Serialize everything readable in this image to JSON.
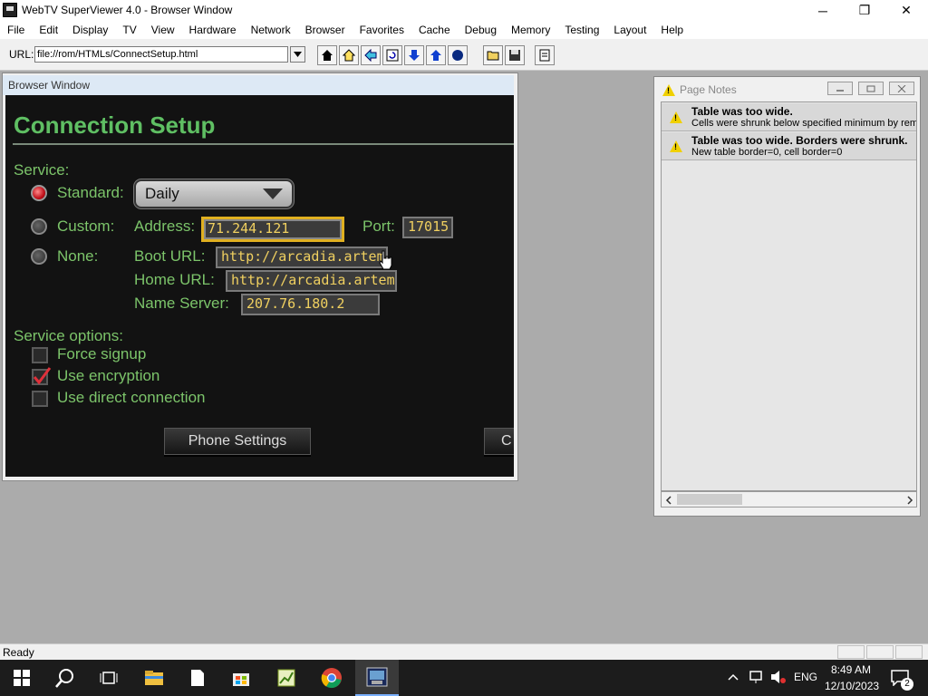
{
  "window": {
    "title": "WebTV SuperViewer 4.0 - Browser Window",
    "minimize_glyph": "─",
    "maximize_glyph": "❐",
    "close_glyph": "✕"
  },
  "menu": [
    "File",
    "Edit",
    "Display",
    "TV",
    "View",
    "Hardware",
    "Network",
    "Browser",
    "Favorites",
    "Cache",
    "Debug",
    "Memory",
    "Testing",
    "Layout",
    "Help"
  ],
  "toolbar": {
    "url_label": "URL:",
    "url_value": "file://rom/HTMLs/ConnectSetup.html",
    "buttons": [
      "home-dark-icon",
      "home-icon",
      "back-arrow-icon",
      "reload-icon",
      "down-arrow-icon",
      "up-arrow-icon",
      "stop-icon",
      "open-folder-icon",
      "save-disk-icon",
      "page-icon"
    ]
  },
  "browser_window": {
    "title": "Browser Window",
    "heading": "Connection Setup",
    "service_label": "Service:",
    "standard_label": "Standard:",
    "standard_value": "Daily",
    "custom_label": "Custom:",
    "address_label": "Address:",
    "address_value": "71.244.121",
    "port_label": "Port:",
    "port_value": "17015",
    "none_label": "None:",
    "boot_url_label": "Boot URL:",
    "boot_url_value": "http://arcadia.artem",
    "home_url_label": "Home URL:",
    "home_url_value": "http://arcadia.artem",
    "name_server_label": "Name Server:",
    "name_server_value": "207.76.180.2",
    "service_options_label": "Service options:",
    "force_signup_label": "Force signup",
    "use_encryption_label": "Use encryption",
    "use_direct_label": "Use direct connection",
    "phone_settings_label": "Phone Settings",
    "cutoff_button_label": "C"
  },
  "page_notes": {
    "title": "Page Notes",
    "notes": [
      {
        "heading": "Table was too wide.",
        "detail": "Cells were shrunk below specified minimum by removi"
      },
      {
        "heading": "Table was too wide. Borders were shrunk.",
        "detail": "New table border=0, cell border=0"
      }
    ]
  },
  "status": {
    "text": "Ready"
  },
  "taskbar": {
    "language": "ENG",
    "time": "8:49 AM",
    "date": "12/10/2023",
    "notification_count": "2"
  }
}
